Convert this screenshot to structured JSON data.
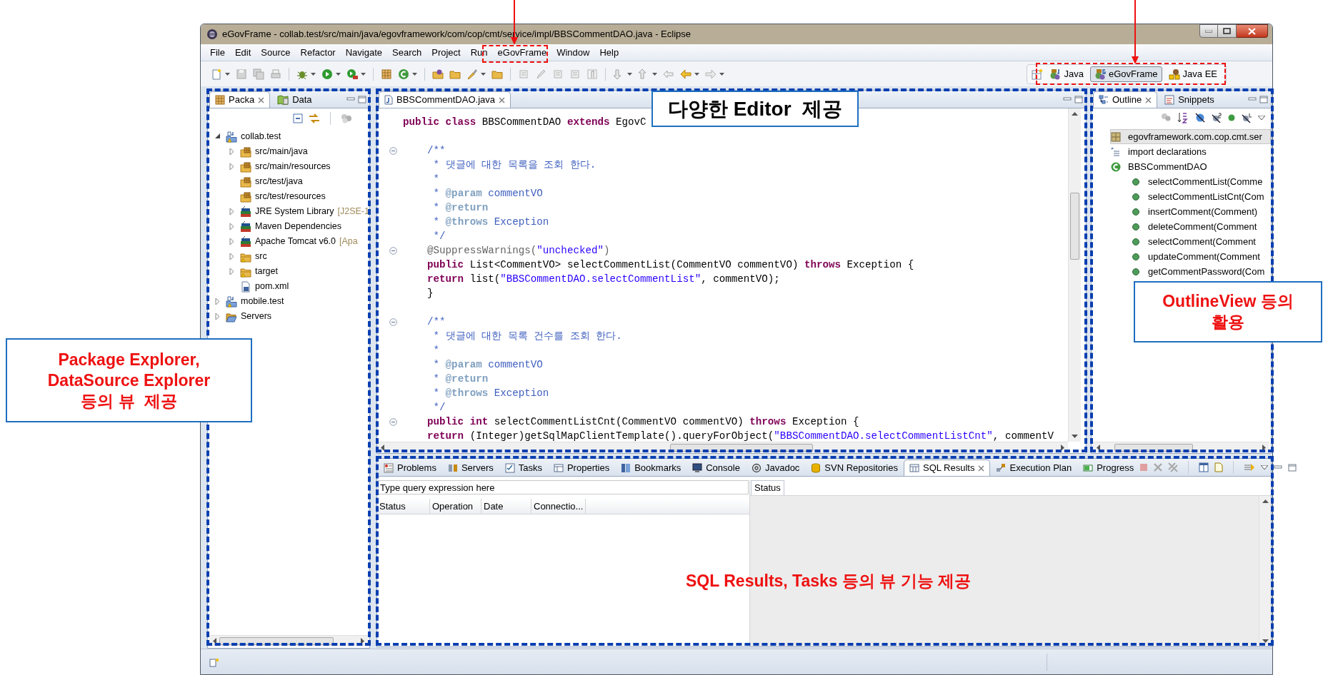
{
  "window": {
    "title": "eGovFrame - collab.test/src/main/java/egovframework/com/cop/cmt/service/impl/BBSCommentDAO.java - Eclipse"
  },
  "menu": [
    "File",
    "Edit",
    "Source",
    "Refactor",
    "Navigate",
    "Search",
    "Project",
    "Run",
    "eGovFrame",
    "Window",
    "Help"
  ],
  "perspectives": [
    {
      "label": "Java",
      "selected": false
    },
    {
      "label": "eGovFrame",
      "selected": true
    },
    {
      "label": "Java EE",
      "selected": false
    }
  ],
  "package_explorer": {
    "tabs": [
      {
        "label": "Packa",
        "selected": true
      },
      {
        "label": "Data",
        "selected": false
      }
    ],
    "tree": [
      {
        "label": "collab.test",
        "kind": "project",
        "expanded": true,
        "children": [
          {
            "label": "src/main/java",
            "kind": "source_folder",
            "expanded": false
          },
          {
            "label": "src/main/resources",
            "kind": "source_folder",
            "expanded": false
          },
          {
            "label": "src/test/java",
            "kind": "source_folder"
          },
          {
            "label": "src/test/resources",
            "kind": "source_folder"
          },
          {
            "label": "JRE System Library",
            "detail": "[J2SE-1",
            "kind": "library",
            "expanded": false
          },
          {
            "label": "Maven Dependencies",
            "kind": "library",
            "expanded": false
          },
          {
            "label": "Apache Tomcat v6.0",
            "detail": "[Apa",
            "kind": "library",
            "expanded": false
          },
          {
            "label": "src",
            "kind": "folder",
            "expanded": false
          },
          {
            "label": "target",
            "kind": "folder",
            "expanded": false
          },
          {
            "label": "pom.xml",
            "kind": "file"
          }
        ]
      },
      {
        "label": "mobile.test",
        "kind": "project",
        "expanded": false
      },
      {
        "label": "Servers",
        "kind": "open_folder",
        "expanded": false
      }
    ]
  },
  "editor": {
    "tabs": [
      {
        "label": "BBSCommentDAO.java",
        "selected": true
      }
    ],
    "lines": [
      {
        "kind": "code",
        "fold": false,
        "tokens": [
          {
            "kind": "keyword",
            "text": "public class"
          },
          {
            "kind": "plain",
            "text": " BBSCommentDAO "
          },
          {
            "kind": "keyword",
            "text": "extends"
          },
          {
            "kind": "plain",
            "text": " EgovC"
          }
        ]
      },
      {
        "kind": "blank"
      },
      {
        "kind": "code",
        "fold": true,
        "tokens": [
          {
            "kind": "comment",
            "text": "    /**"
          }
        ]
      },
      {
        "kind": "code",
        "fold": false,
        "tokens": [
          {
            "kind": "comment",
            "text": "     * 댓글에 대한 목록을 조회 한다."
          }
        ]
      },
      {
        "kind": "code",
        "fold": false,
        "tokens": [
          {
            "kind": "comment",
            "text": "     *"
          }
        ]
      },
      {
        "kind": "code",
        "fold": false,
        "tokens": [
          {
            "kind": "comment",
            "text": "     * "
          },
          {
            "kind": "doctag",
            "text": "@param"
          },
          {
            "kind": "comment",
            "text": " commentVO"
          }
        ]
      },
      {
        "kind": "code",
        "fold": false,
        "tokens": [
          {
            "kind": "comment",
            "text": "     * "
          },
          {
            "kind": "doctag",
            "text": "@return"
          }
        ]
      },
      {
        "kind": "code",
        "fold": false,
        "tokens": [
          {
            "kind": "comment",
            "text": "     * "
          },
          {
            "kind": "doctag",
            "text": "@throws"
          },
          {
            "kind": "comment",
            "text": " Exception"
          }
        ]
      },
      {
        "kind": "code",
        "fold": false,
        "tokens": [
          {
            "kind": "comment",
            "text": "     */"
          }
        ]
      },
      {
        "kind": "code",
        "fold": true,
        "tokens": [
          {
            "kind": "annotation",
            "text": "    @SuppressWarnings("
          },
          {
            "kind": "string",
            "text": "\"unchecked\""
          },
          {
            "kind": "annotation",
            "text": ")"
          }
        ]
      },
      {
        "kind": "code",
        "fold": false,
        "tokens": [
          {
            "kind": "keyword",
            "text": "    public"
          },
          {
            "kind": "plain",
            "text": " List<CommentVO> selectCommentList(CommentVO commentVO) "
          },
          {
            "kind": "keyword",
            "text": "throws"
          },
          {
            "kind": "plain",
            "text": " Exception {"
          }
        ]
      },
      {
        "kind": "code",
        "fold": false,
        "tokens": [
          {
            "kind": "keyword",
            "text": "    return"
          },
          {
            "kind": "plain",
            "text": " list("
          },
          {
            "kind": "string",
            "text": "\"BBSCommentDAO.selectCommentList\""
          },
          {
            "kind": "plain",
            "text": ", commentVO);"
          }
        ]
      },
      {
        "kind": "code",
        "fold": false,
        "tokens": [
          {
            "kind": "plain",
            "text": "    }"
          }
        ]
      },
      {
        "kind": "blank"
      },
      {
        "kind": "code",
        "fold": true,
        "tokens": [
          {
            "kind": "comment",
            "text": "    /**"
          }
        ]
      },
      {
        "kind": "code",
        "fold": false,
        "tokens": [
          {
            "kind": "comment",
            "text": "     * 댓글에 대한 목록 건수를 조회 한다."
          }
        ]
      },
      {
        "kind": "code",
        "fold": false,
        "tokens": [
          {
            "kind": "comment",
            "text": "     *"
          }
        ]
      },
      {
        "kind": "code",
        "fold": false,
        "tokens": [
          {
            "kind": "comment",
            "text": "     * "
          },
          {
            "kind": "doctag",
            "text": "@param"
          },
          {
            "kind": "comment",
            "text": " commentVO"
          }
        ]
      },
      {
        "kind": "code",
        "fold": false,
        "tokens": [
          {
            "kind": "comment",
            "text": "     * "
          },
          {
            "kind": "doctag",
            "text": "@return"
          }
        ]
      },
      {
        "kind": "code",
        "fold": false,
        "tokens": [
          {
            "kind": "comment",
            "text": "     * "
          },
          {
            "kind": "doctag",
            "text": "@throws"
          },
          {
            "kind": "comment",
            "text": " Exception"
          }
        ]
      },
      {
        "kind": "code",
        "fold": false,
        "tokens": [
          {
            "kind": "comment",
            "text": "     */"
          }
        ]
      },
      {
        "kind": "code",
        "fold": true,
        "tokens": [
          {
            "kind": "keyword",
            "text": "    public int"
          },
          {
            "kind": "plain",
            "text": " selectCommentListCnt(CommentVO commentVO) "
          },
          {
            "kind": "keyword",
            "text": "throws"
          },
          {
            "kind": "plain",
            "text": " Exception {"
          }
        ]
      },
      {
        "kind": "code",
        "fold": false,
        "tokens": [
          {
            "kind": "keyword",
            "text": "    return"
          },
          {
            "kind": "plain",
            "text": " (Integer)getSqlMapClientTemplate().queryForObject("
          },
          {
            "kind": "string",
            "text": "\"BBSCommentDAO.selectCommentListCnt\""
          },
          {
            "kind": "plain",
            "text": ", commentV"
          }
        ]
      }
    ]
  },
  "outline": {
    "tabs": [
      {
        "label": "Outline",
        "selected": true
      },
      {
        "label": "Snippets",
        "selected": false
      }
    ],
    "items": [
      {
        "label": "egovframework.com.cop.cmt.ser",
        "kind": "package",
        "selected": true
      },
      {
        "label": "import declarations",
        "kind": "imports",
        "selected": false
      },
      {
        "label": "BBSCommentDAO",
        "kind": "class",
        "selected": false,
        "children": [
          {
            "label": "selectCommentList(Comme",
            "kind": "method",
            "selected": false
          },
          {
            "label": "selectCommentListCnt(Com",
            "kind": "method",
            "selected": false
          },
          {
            "label": "insertComment(Comment)",
            "kind": "method",
            "selected": false
          },
          {
            "label": "deleteComment(Comment",
            "kind": "method",
            "selected": false
          },
          {
            "label": "selectComment(Comment",
            "kind": "method",
            "selected": false
          },
          {
            "label": "updateComment(Comment",
            "kind": "method",
            "selected": false
          },
          {
            "label": "getCommentPassword(Com",
            "kind": "method",
            "selected": false
          }
        ]
      }
    ]
  },
  "bottom_panel": {
    "tabs": [
      {
        "label": "Problems",
        "selected": false
      },
      {
        "label": "Servers",
        "selected": false
      },
      {
        "label": "Tasks",
        "selected": false
      },
      {
        "label": "Properties",
        "selected": false
      },
      {
        "label": "Bookmarks",
        "selected": false
      },
      {
        "label": "Console",
        "selected": false
      },
      {
        "label": "Javadoc",
        "selected": false
      },
      {
        "label": "SVN Repositories",
        "selected": false
      },
      {
        "label": "SQL Results",
        "selected": true
      },
      {
        "label": "Execution Plan",
        "selected": false
      },
      {
        "label": "Progress",
        "selected": false
      }
    ],
    "query_field": {
      "placeholder": "Type query expression here"
    },
    "columns": [
      "Status",
      "Operation",
      "Date",
      "Connectio..."
    ],
    "detail_tabs": [
      {
        "label": "Status",
        "selected": true
      }
    ]
  },
  "callouts": [
    {
      "text": "다양한 Editor  제공"
    },
    {
      "text": "OutlineView 등의\n활용"
    },
    {
      "text": "Package Explorer,\nDataSource Explorer\n등의 뷰  제공"
    },
    {
      "text": "SQL Results, Tasks 등의 뷰 기능 제공"
    }
  ]
}
